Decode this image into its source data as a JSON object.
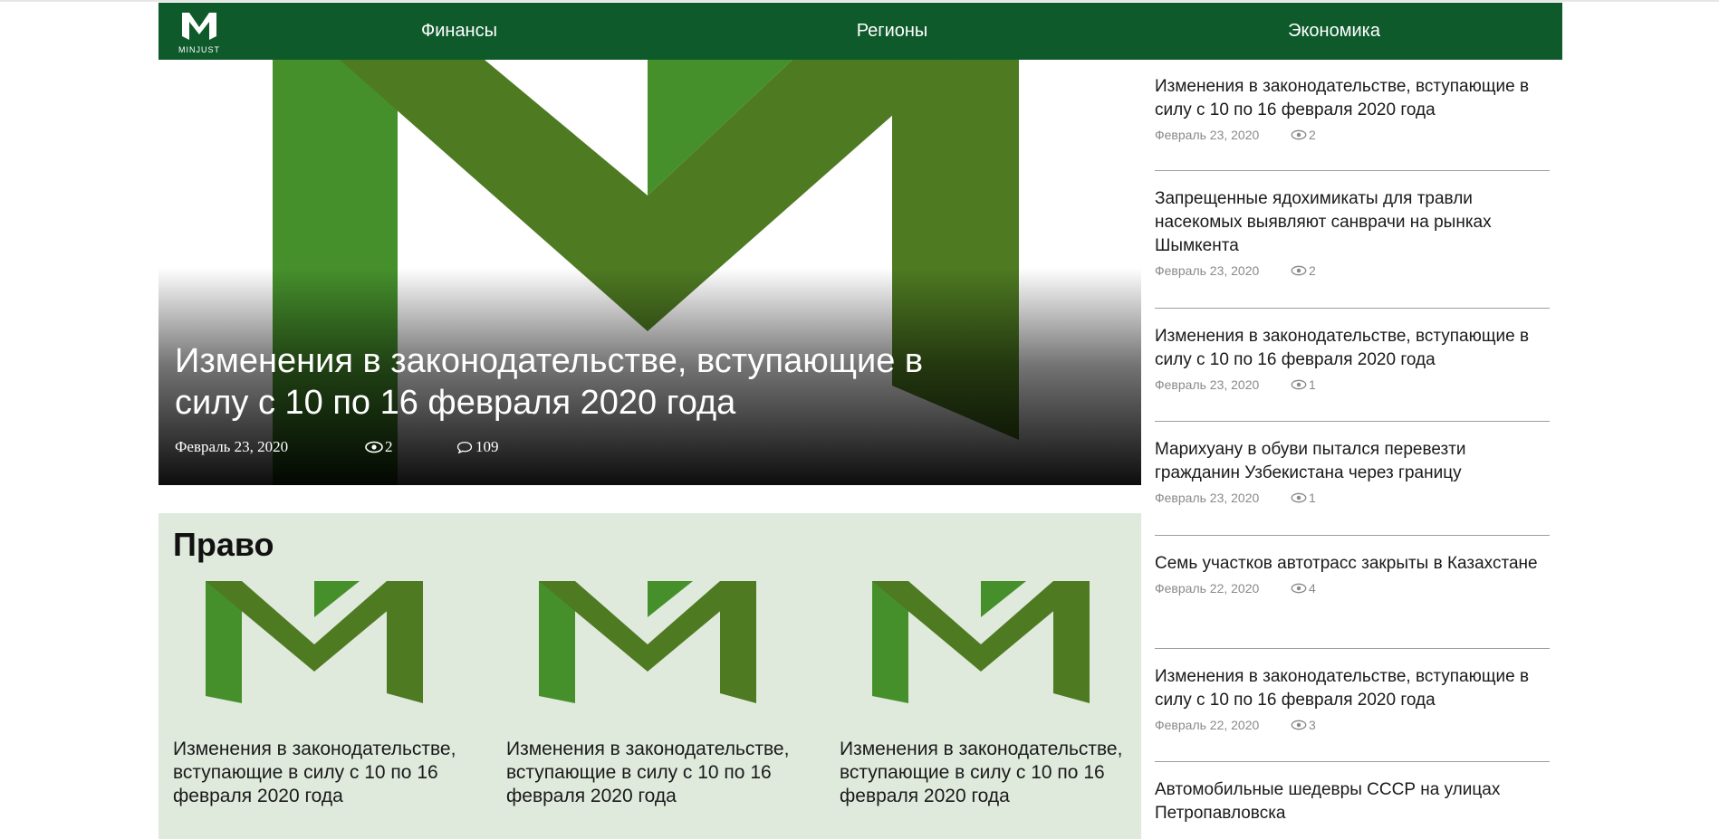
{
  "header": {
    "logo_text": "MINJUST",
    "nav": [
      "Финансы",
      "Регионы",
      "Экономика"
    ]
  },
  "hero": {
    "title": "Изменения в законодательстве, вступающие в силу с 10 по 16 февраля 2020 года",
    "date": "Февраль 23, 2020",
    "views": "2",
    "comments": "109"
  },
  "sidebar": {
    "items": [
      {
        "title": "Изменения в законодательстве, вступающие в силу с 10 по 16 февраля 2020 года",
        "date": "Февраль 23, 2020",
        "views": "2"
      },
      {
        "title": "Запрещенные ядохимикаты для травли насекомых выявляют санврачи на рынках Шымкента",
        "date": "Февраль 23, 2020",
        "views": "2"
      },
      {
        "title": "Изменения в законодательстве, вступающие в силу с 10 по 16 февраля 2020 года",
        "date": "Февраль 23, 2020",
        "views": "1"
      },
      {
        "title": "Марихуану в обуви пытался перевезти гражданин Узбекистана через границу",
        "date": "Февраль 23, 2020",
        "views": "1"
      },
      {
        "title": "Семь участков автотрасс закрыты в Казахстане",
        "date": "Февраль 22, 2020",
        "views": "4"
      },
      {
        "title": "Изменения в законодательстве, вступающие в силу с 10 по 16 февраля 2020 года",
        "date": "Февраль 22, 2020",
        "views": "3"
      },
      {
        "title": "Автомобильные шедевры СССР на улицах Петропавловска",
        "date": "",
        "views": ""
      }
    ]
  },
  "section": {
    "title": "Право",
    "cards": [
      {
        "title": "Изменения в законодательстве, вступающие в силу с 10 по 16 февраля 2020 года"
      },
      {
        "title": "Изменения в законодательстве, вступающие в силу с 10 по 16 февраля 2020 года"
      },
      {
        "title": "Изменения в законодательстве, вступающие в силу с 10 по 16 февраля 2020 года"
      }
    ]
  },
  "colors": {
    "header_bg": "#0e5a2b",
    "logo_green_light": "#46902c",
    "logo_green_dark": "#4e7a22",
    "section_bg": "#dfeadd"
  },
  "icons": [
    "minjust-logo-icon",
    "eye-icon",
    "comment-icon"
  ]
}
